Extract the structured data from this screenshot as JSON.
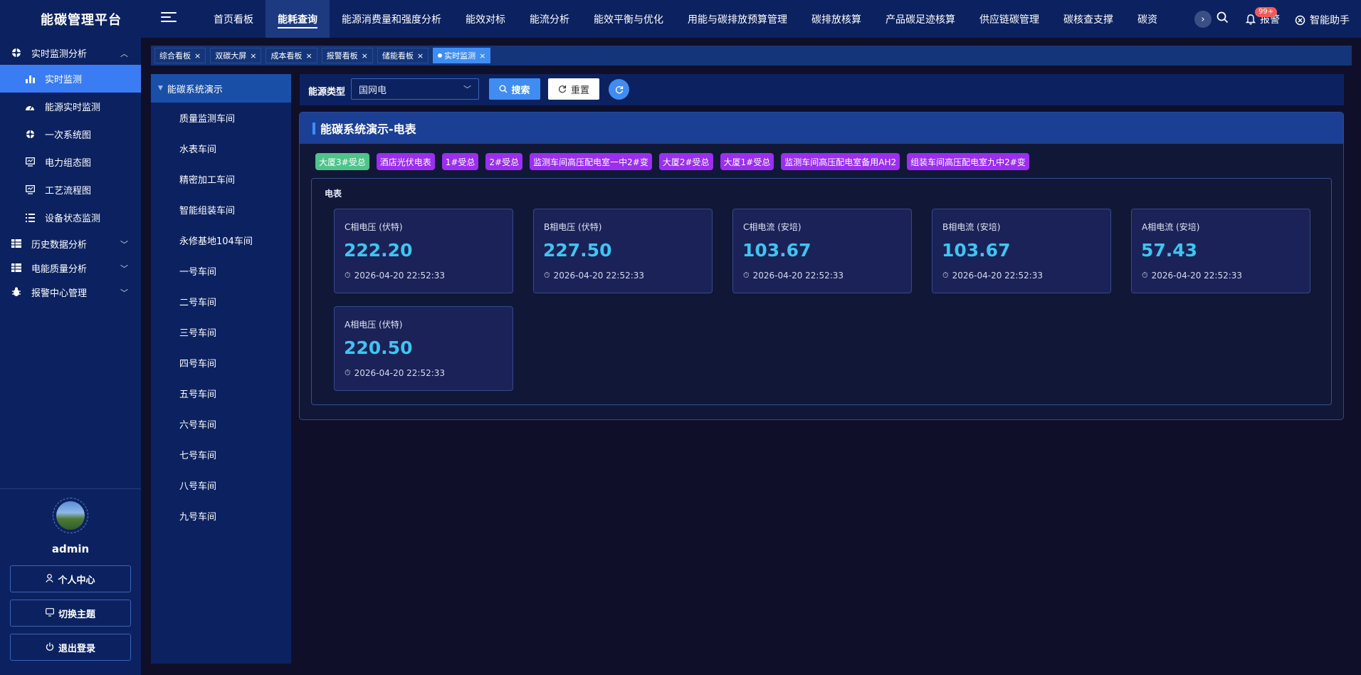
{
  "app": {
    "title": "能碳管理平台"
  },
  "topnav": {
    "items": [
      {
        "label": "首页看板"
      },
      {
        "label": "能耗查询"
      },
      {
        "label": "能源消费量和强度分析"
      },
      {
        "label": "能效对标"
      },
      {
        "label": "能流分析"
      },
      {
        "label": "能效平衡与优化"
      },
      {
        "label": "用能与碳排放预算管理"
      },
      {
        "label": "碳排放核算"
      },
      {
        "label": "产品碳足迹核算"
      },
      {
        "label": "供应链碳管理"
      },
      {
        "label": "碳核查支撑"
      },
      {
        "label": "碳资"
      }
    ],
    "active_index": 1,
    "alarm_label": "报警",
    "alarm_badge": "99+",
    "assistant_label": "智能助手"
  },
  "sidebar": {
    "group1": {
      "label": "实时监测分析"
    },
    "items": [
      {
        "label": "实时监测",
        "icon": "bar-chart-icon"
      },
      {
        "label": "能源实时监测",
        "icon": "dashboard-icon"
      },
      {
        "label": "一次系统图",
        "icon": "target-icon"
      },
      {
        "label": "电力组态图",
        "icon": "monitor-icon"
      },
      {
        "label": "工艺流程图",
        "icon": "monitor-icon"
      },
      {
        "label": "设备状态监测",
        "icon": "list-icon"
      }
    ],
    "group2": {
      "label": "历史数据分析"
    },
    "group3": {
      "label": "电能质量分析"
    },
    "group4": {
      "label": "报警中心管理"
    },
    "user": {
      "name": "admin"
    },
    "buttons": {
      "profile": "个人中心",
      "theme": "切换主题",
      "logout": "退出登录"
    }
  },
  "tabs": [
    {
      "label": "综合看板"
    },
    {
      "label": "双碳大屏"
    },
    {
      "label": "成本看板"
    },
    {
      "label": "报警看板"
    },
    {
      "label": "储能看板"
    },
    {
      "label": "实时监测"
    }
  ],
  "tree": {
    "root": "能碳系统演示",
    "nodes": [
      "质量监测车间",
      "水表车间",
      "精密加工车间",
      "智能组装车间",
      "永修基地104车间",
      "一号车间",
      "二号车间",
      "三号车间",
      "四号车间",
      "五号车间",
      "六号车间",
      "七号车间",
      "八号车间",
      "九号车间"
    ]
  },
  "filter": {
    "label": "能源类型",
    "select_value": "国网电",
    "search_label": "搜索",
    "reset_label": "重置"
  },
  "panel": {
    "title": "能碳系统演示-电表",
    "chips": [
      {
        "label": "大厦3#受总",
        "color": "#4ec48a"
      },
      {
        "label": "酒店光伏电表",
        "color": "#9a2ff0"
      },
      {
        "label": "1#受总",
        "color": "#9a2ff0"
      },
      {
        "label": "2#受总",
        "color": "#9a2ff0"
      },
      {
        "label": "监测车间高压配电室一中2#变",
        "color": "#9a2ff0"
      },
      {
        "label": "大厦2#受总",
        "color": "#9a2ff0"
      },
      {
        "label": "大厦1#受总",
        "color": "#9a2ff0"
      },
      {
        "label": "监测车间高压配电室备用AH2",
        "color": "#9a2ff0"
      },
      {
        "label": "组装车间高压配电室九中2#变",
        "color": "#9a2ff0"
      }
    ],
    "meter_title": "电表",
    "cards": [
      {
        "label": "C相电压 (伏特)",
        "value": "222.20",
        "time": "2026-04-20 22:52:33"
      },
      {
        "label": "B相电压 (伏特)",
        "value": "227.50",
        "time": "2026-04-20 22:52:33"
      },
      {
        "label": "C相电流 (安培)",
        "value": "103.67",
        "time": "2026-04-20 22:52:33"
      },
      {
        "label": "B相电流 (安培)",
        "value": "103.67",
        "time": "2026-04-20 22:52:33"
      },
      {
        "label": "A相电流 (安培)",
        "value": "57.43",
        "time": "2026-04-20 22:52:33"
      },
      {
        "label": "A相电压 (伏特)",
        "value": "220.50",
        "time": "2026-04-20 22:52:33"
      }
    ]
  },
  "colors": {
    "accent": "#3f8df2",
    "value_text": "#3ec5f2",
    "chip_purple": "#9a2ff0",
    "chip_green": "#4ec48a"
  }
}
